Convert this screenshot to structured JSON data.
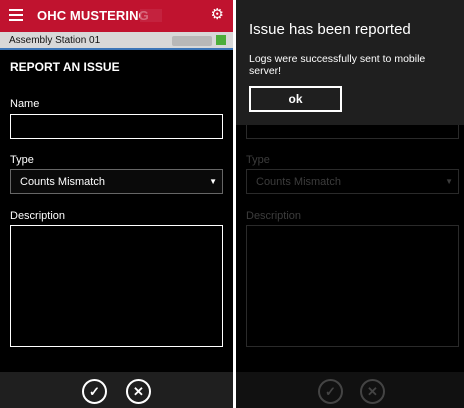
{
  "app": {
    "title": "OHC MUSTERING"
  },
  "station": {
    "name": "Assembly Station 01",
    "status_color": "#4cae3a"
  },
  "form": {
    "title": "REPORT AN ISSUE",
    "name_label": "Name",
    "name_value": "",
    "type_label": "Type",
    "type_value": "Counts Mismatch",
    "description_label": "Description",
    "description_value": ""
  },
  "actions": {
    "confirm_icon": "checkmark-circle-icon",
    "cancel_icon": "close-circle-icon"
  },
  "dialog": {
    "title": "Issue has been reported",
    "message": "Logs were successfully sent to mobile server!",
    "ok_label": "ok"
  },
  "colors": {
    "header": "#c0132f",
    "accent_line": "#3c76b8"
  }
}
